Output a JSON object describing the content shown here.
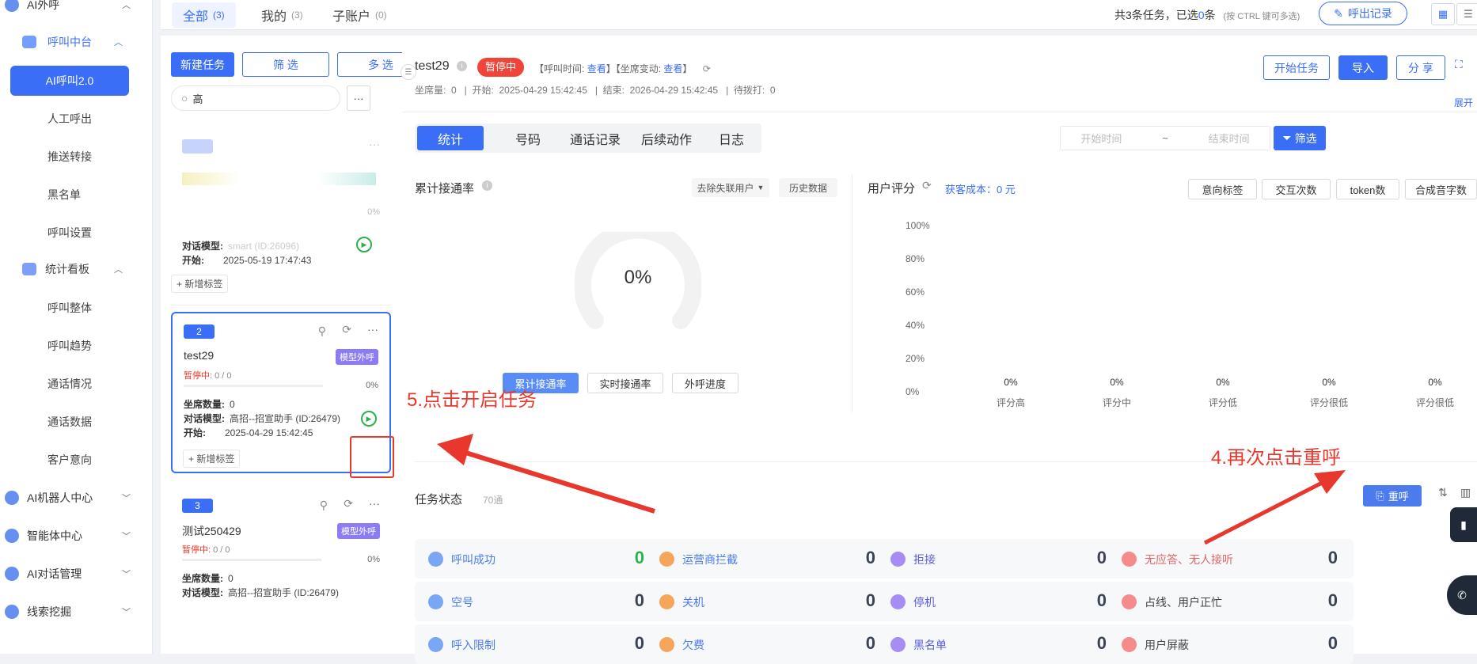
{
  "sidebar": {
    "top_group": "AI外呼",
    "call_center": "呼叫中台",
    "active_item": "AI呼叫2.0",
    "items": [
      "人工呼出",
      "推送转接",
      "黑名单",
      "呼叫设置"
    ],
    "stats_group": "统计看板",
    "stats_items": [
      "呼叫整体",
      "呼叫趋势",
      "通话情况",
      "通话数据",
      "客户意向"
    ],
    "groups": [
      "AI机器人中心",
      "智能体中心",
      "AI对话管理",
      "线索挖掘"
    ]
  },
  "topbar": {
    "tabs": [
      {
        "label": "全部",
        "count": "(3)"
      },
      {
        "label": "我的",
        "count": "(3)"
      },
      {
        "label": "子账户",
        "count": "(0)"
      }
    ],
    "summary_prefix": "共3条任务，已选",
    "summary_selected": "0",
    "summary_suffix": "条",
    "hint": "(按 CTRL 键可多选)",
    "records_btn": "呼出记录"
  },
  "list": {
    "new_task": "新建任务",
    "filter": "筛 选",
    "multi": "多 选",
    "search_value": "高",
    "more": "···",
    "cards": [
      {
        "pct": "0%",
        "model_label": "对话模型:",
        "model": "smart (ID:26096)",
        "start_label": "开始:",
        "start": "2025-05-19 17:47:43",
        "add_tag": "新增标签"
      },
      {
        "num": "2",
        "name": "test29",
        "tag": "模型外呼",
        "status": "暂停中:",
        "progress": "0 / 0",
        "pct": "0%",
        "seats_label": "坐席数量:",
        "seats": "0",
        "model_label": "对话模型:",
        "model": "高招--招宣助手 (ID:26479)",
        "start_label": "开始:",
        "start": "2025-04-29 15:42:45",
        "add_tag": "新增标签"
      },
      {
        "num": "3",
        "name": "测试250429",
        "tag": "模型外呼",
        "status": "暂停中:",
        "progress": "0 / 0",
        "pct": "0%",
        "seats_label": "坐席数量:",
        "seats": "0",
        "model_label": "对话模型:",
        "model": "高招--招宣助手 (ID:26479)"
      }
    ]
  },
  "header": {
    "title": "test29",
    "status": "暂停中",
    "call_time_label": "【呼叫时间:",
    "call_time_link": "查看",
    "seat_change_label": "】【坐席变动:",
    "seat_change_link": "查看",
    "close_bracket": "】",
    "meta": "坐席量:  0   |  开始:  2025-04-29 15:42:45   |  结束:  2026-04-29 15:42:45   |  待拨打:  0",
    "start_btn": "开始任务",
    "import_btn": "导入",
    "share_btn": "分 享",
    "expand": "展开"
  },
  "subtabs": [
    "统计",
    "号码",
    "通话记录",
    "后续动作",
    "日志"
  ],
  "date_filter": {
    "start": "开始时间",
    "sep": "~",
    "end": "结束时间",
    "btn": "筛选"
  },
  "rate_panel": {
    "title": "累计接通率",
    "dropdown": "去除失联用户",
    "history": "历史数据",
    "value": "0%",
    "btns": [
      "累计接通率",
      "实时接通率",
      "外呼进度"
    ]
  },
  "score_panel": {
    "title": "用户评分",
    "cost_label": "获客成本：",
    "cost_value": "0 元",
    "btns": [
      "意向标签",
      "交互次数",
      "token数",
      "合成音字数"
    ]
  },
  "chart_data": {
    "type": "bar",
    "title": "用户评分",
    "categories": [
      "评分高",
      "评分中",
      "评分低",
      "评分很低",
      "评分很低"
    ],
    "values": [
      0,
      0,
      0,
      0,
      0
    ],
    "value_labels": [
      "0%",
      "0%",
      "0%",
      "0%",
      "0%"
    ],
    "yticks": [
      "100%",
      "80%",
      "60%",
      "40%",
      "20%",
      "0%"
    ],
    "ylim": [
      0,
      100
    ]
  },
  "status_panel": {
    "title": "任务状态",
    "subtitle": "70通",
    "recall_btn": "重呼",
    "cells": [
      {
        "label": "呼叫成功",
        "value": "0",
        "color": "#7aa7f5",
        "val_color": "#2bb24c"
      },
      {
        "label": "运营商拦截",
        "value": "0",
        "color": "#f5a65b"
      },
      {
        "label": "拒接",
        "value": "0",
        "color": "#a88cf5"
      },
      {
        "label": "无应答、无人接听",
        "value": "0",
        "color": "#f58c8c"
      },
      {
        "label": "空号",
        "value": "0",
        "color": "#7aa7f5"
      },
      {
        "label": "关机",
        "value": "0",
        "color": "#f5a65b"
      },
      {
        "label": "停机",
        "value": "0",
        "color": "#a88cf5"
      },
      {
        "label": "占线、用户正忙",
        "value": "0",
        "color": "#f58c8c"
      },
      {
        "label": "呼入限制",
        "value": "0",
        "color": "#7aa7f5"
      },
      {
        "label": "欠费",
        "value": "0",
        "color": "#f5a65b"
      },
      {
        "label": "黑名单",
        "value": "0",
        "color": "#a88cf5"
      },
      {
        "label": "用户屏蔽",
        "value": "0",
        "color": "#f58c8c"
      }
    ]
  },
  "annotations": {
    "step5": "5.点击开启任务",
    "step4": "4.再次点击重呼"
  }
}
